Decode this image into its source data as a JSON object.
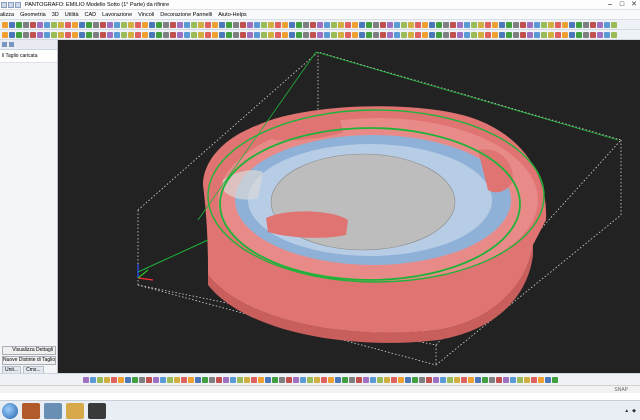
{
  "window": {
    "title": "PANTOGRAFO: EMILIO Modello Sotto (1° Parte) da rifinire"
  },
  "menu": {
    "items": [
      "alizza",
      "Geometria",
      "3D",
      "Utilità",
      "CAD",
      "Lavorazione",
      "Vincoli",
      "Decorazione Pannelli",
      "Aiuto-Helps"
    ]
  },
  "left_panel": {
    "section_label": "li Taglio caricata",
    "visualizza_button": "Visualizza Dettagli",
    "nuove_button": "Nuove Distinte di Taglio",
    "tabs": [
      "Unit...",
      "Cms..."
    ]
  },
  "status": {
    "snap": "SNAP"
  },
  "colors": {
    "viewport_bg": "#222222",
    "part_fill": "#e07472",
    "pocket_blue": "#8fb1d8",
    "floor_gray": "#bdbdbd",
    "toolpath_green": "#1fb33a",
    "bbox_dotted": "#d8d8d8"
  },
  "icons": {
    "toolbar": "generic-toolbar-icons",
    "axis": "axis-triad-icon"
  }
}
